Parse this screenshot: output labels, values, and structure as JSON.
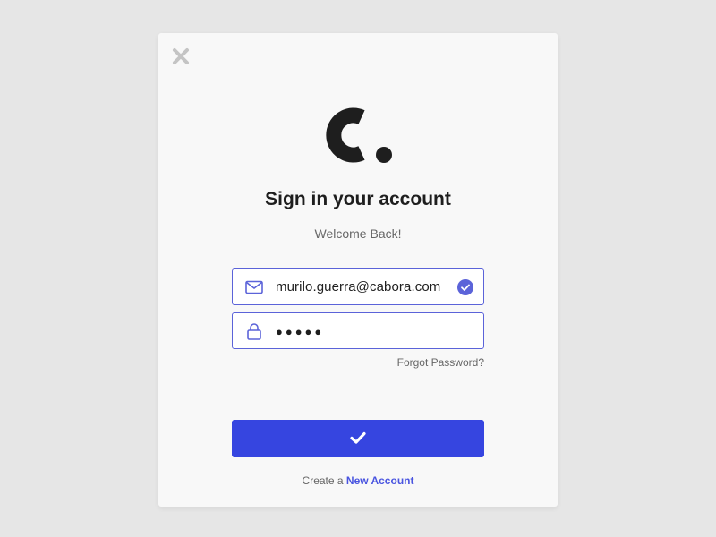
{
  "dialog": {
    "title": "Sign in your account",
    "subtitle": "Welcome Back!"
  },
  "icons": {
    "close": "close-icon",
    "logo": "logo-c-dot",
    "email": "mail-icon",
    "password": "lock-icon",
    "valid": "check-circle-icon",
    "submit": "checkmark-icon"
  },
  "form": {
    "email_value": "murilo.guerra@cabora.com",
    "password_value": "●●●●●",
    "forgot_label": "Forgot Password?"
  },
  "footer": {
    "prefix": "Create a",
    "link_label": "New Account"
  },
  "colors": {
    "accent": "#3645e0",
    "link": "#4a55e0",
    "field_border": "#5b63d9",
    "background": "#e6e6e6",
    "card": "#f8f8f8"
  }
}
